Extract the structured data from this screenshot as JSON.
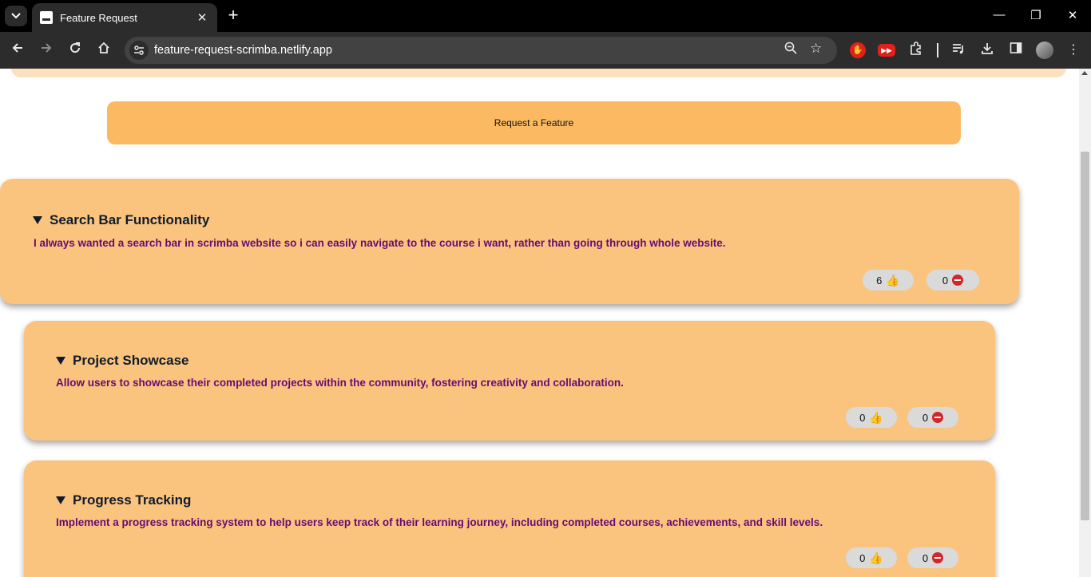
{
  "browser": {
    "tab_title": "Feature Request",
    "url": "feature-request-scrimba.netlify.app",
    "close_tab_glyph": "✕",
    "new_tab_glyph": "+",
    "minimize_glyph": "—",
    "restore_glyph": "❐",
    "close_window_glyph": "✕"
  },
  "page": {
    "request_button_label": "Request a Feature",
    "features": [
      {
        "title": "Search Bar Functionality",
        "description": "I always wanted a search bar in scrimba website so i can easily navigate to the course i want, rather than going through whole website.",
        "likes": "6",
        "dislikes": "0"
      },
      {
        "title": "Project Showcase",
        "description": "Allow users to showcase their completed projects within the community, fostering creativity and collaboration.",
        "likes": "0",
        "dislikes": "0"
      },
      {
        "title": "Progress Tracking",
        "description": "Implement a progress tracking system to help users keep track of their learning journey, including completed courses, achievements, and skill levels.",
        "likes": "0",
        "dislikes": "0"
      }
    ]
  },
  "colors": {
    "card_bg": "#fac47e",
    "button_bg": "#fbb962",
    "title_color": "#0f1b2d",
    "description_color": "#6b0a73",
    "pill_bg": "#dadada"
  },
  "icons": {
    "like": "thumbs-up-icon",
    "dislike": "no-entry-icon",
    "expand": "triangle-down-icon"
  }
}
